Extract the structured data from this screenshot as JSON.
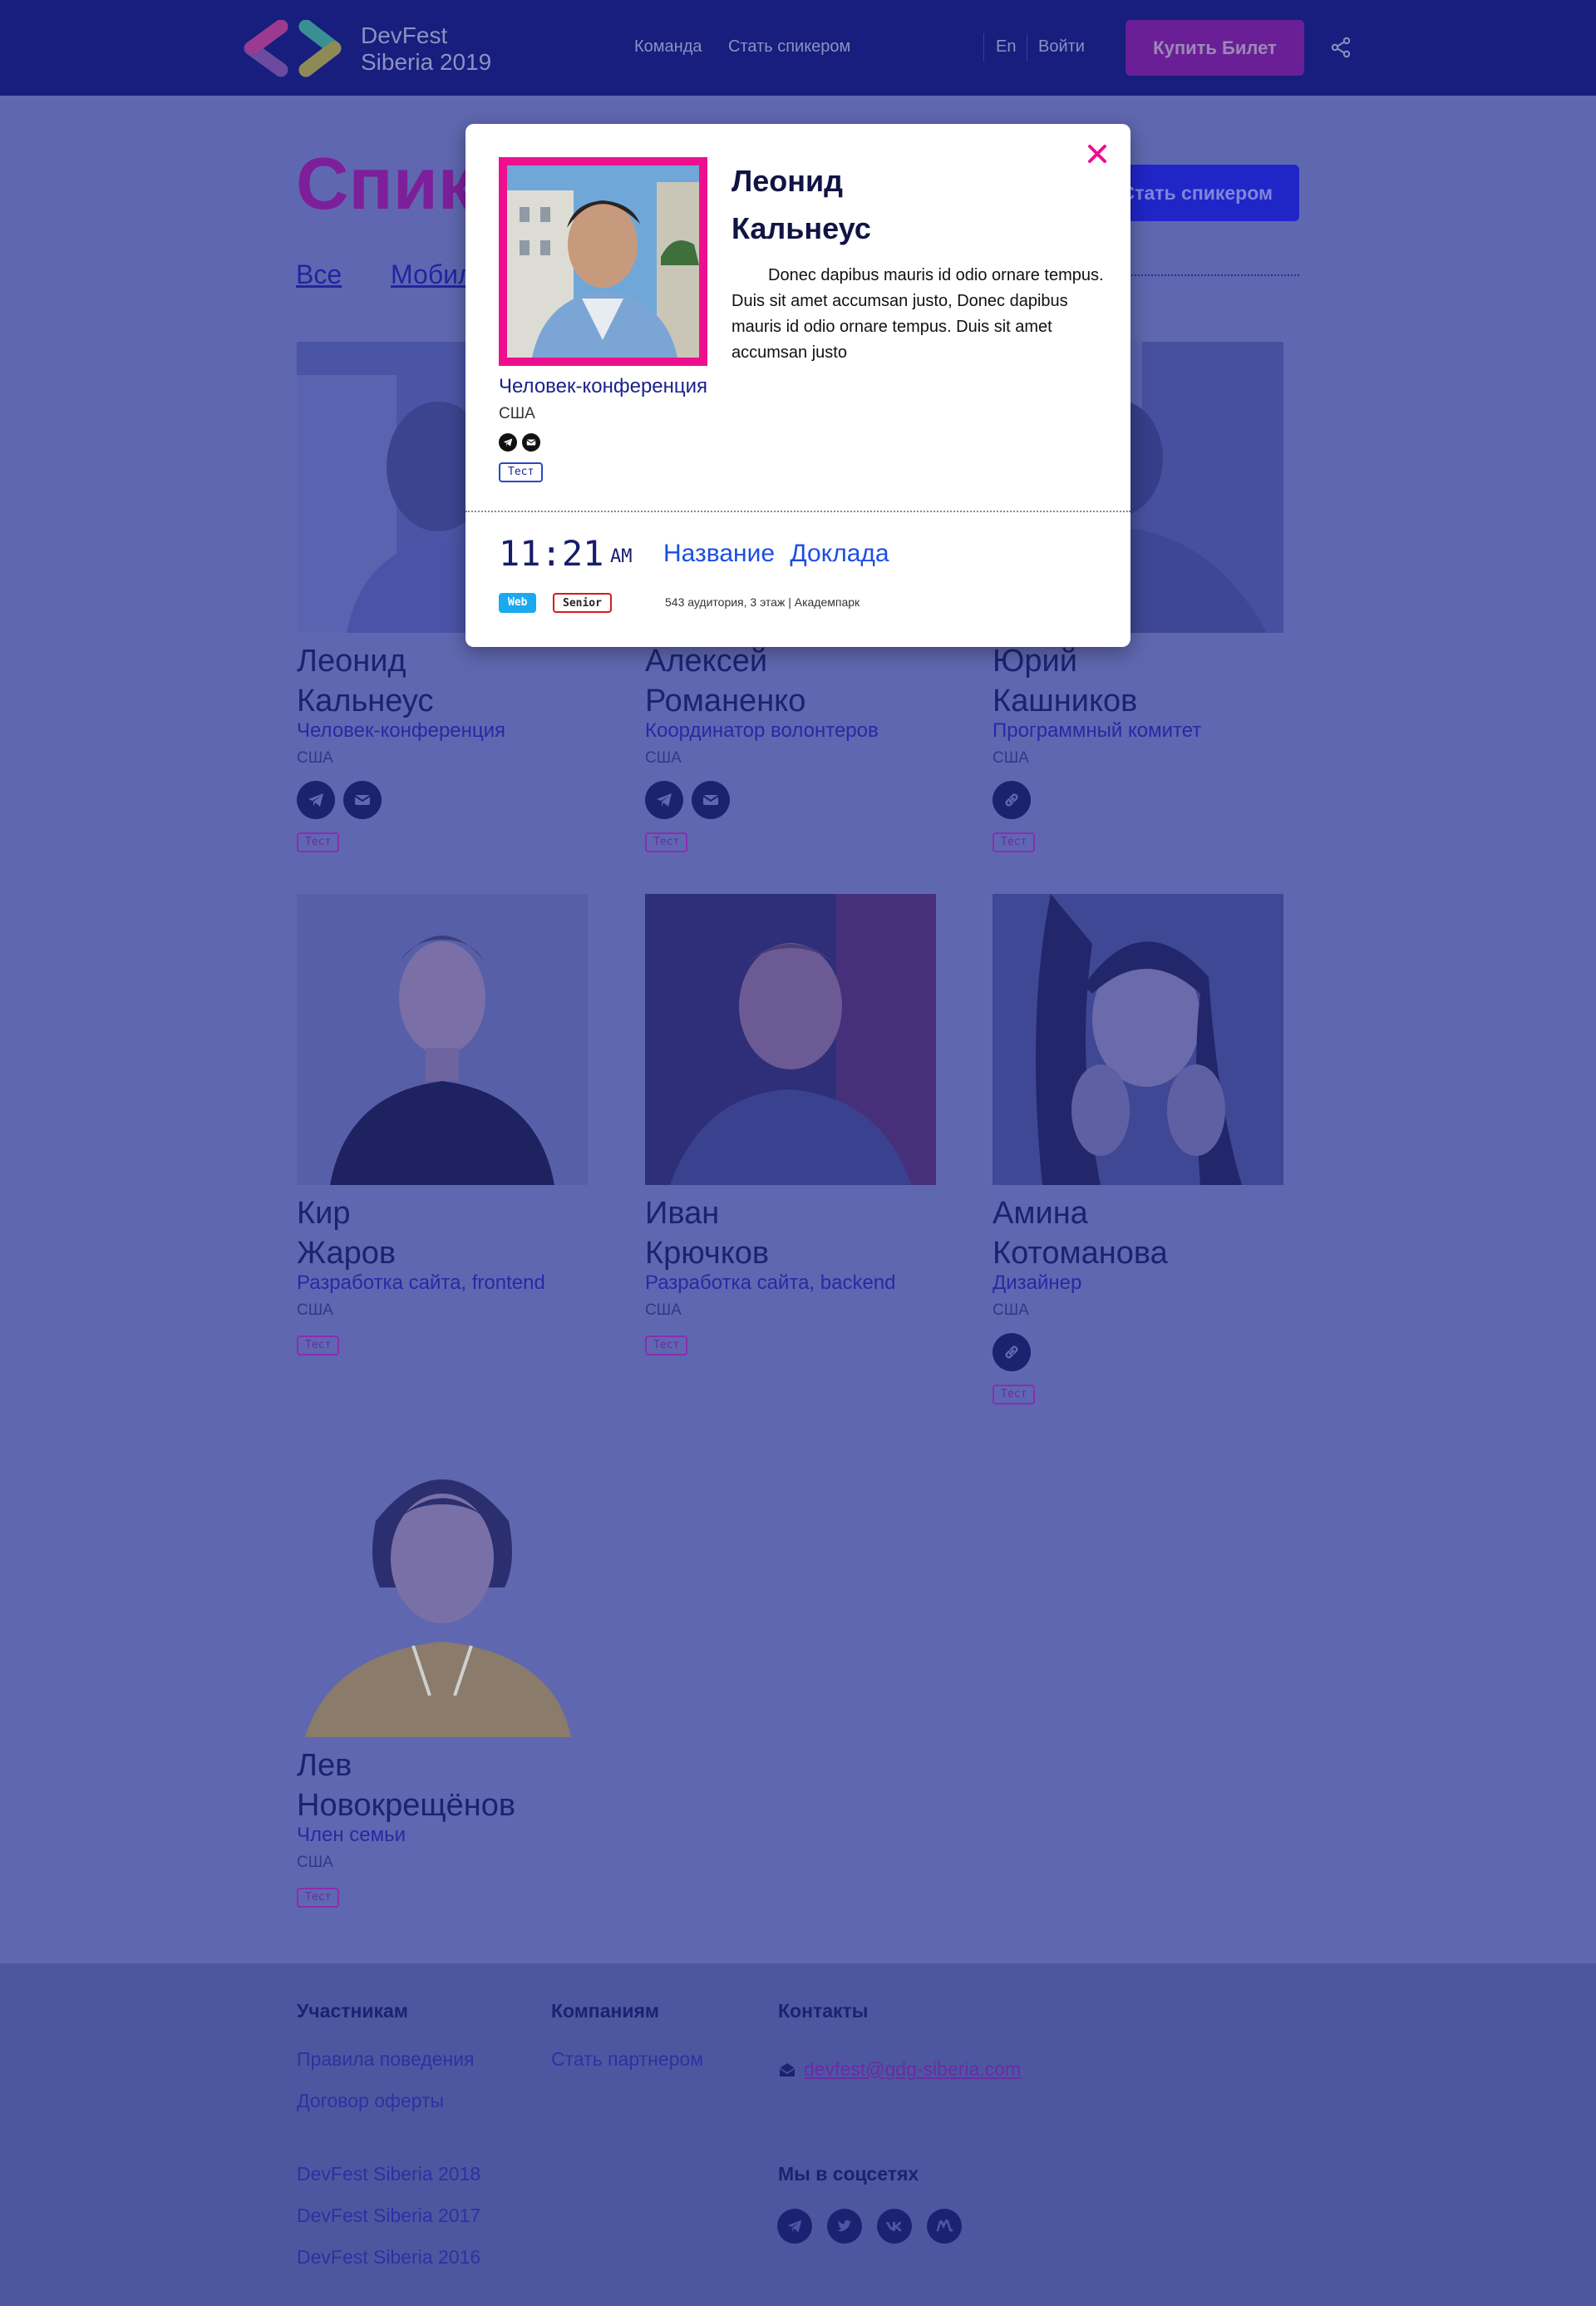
{
  "header": {
    "logo_line1": "DevFest",
    "logo_line2": "Siberia 2019",
    "nav": [
      "Команда",
      "Стать спикером"
    ],
    "lang": "En",
    "login": "Войти",
    "buy_ticket": "Купить Билет"
  },
  "page": {
    "title": "Спикеры",
    "become_speaker": "Стать спикером",
    "filters": [
      "Все",
      "Мобильная разработка"
    ]
  },
  "speakers": [
    {
      "first": "Леонид",
      "last": "Кальнеус",
      "role": "Человек-конференция",
      "country": "США",
      "socials": [
        "telegram-icon",
        "mail-icon"
      ],
      "tag": "Тест"
    },
    {
      "first": "Алексей",
      "last": "Романенко",
      "role": "Координатор волонтеров",
      "country": "США",
      "socials": [
        "telegram-icon",
        "mail-icon"
      ],
      "tag": "Тест"
    },
    {
      "first": "Юрий",
      "last": "Кашников",
      "role": "Программный комитет",
      "country": "США",
      "socials": [
        "link-icon"
      ],
      "tag": "Тест"
    },
    {
      "first": "Кир",
      "last": "Жаров",
      "role": "Разработка сайта, frontend",
      "country": "США",
      "socials": [],
      "tag": "Тест"
    },
    {
      "first": "Иван",
      "last": "Крючков",
      "role": "Разработка сайта, backend",
      "country": "США",
      "socials": [],
      "tag": "Тест"
    },
    {
      "first": "Амина",
      "last": "Котоманова",
      "role": "Дизайнер",
      "country": "США",
      "socials": [
        "link-icon"
      ],
      "tag": "Тест"
    },
    {
      "first": "Лев",
      "last": "Новокрещёнов",
      "role": "Член семьи",
      "country": "США",
      "socials": [],
      "tag": "Тест"
    }
  ],
  "modal": {
    "first": "Леонид",
    "last": "Кальнеус",
    "bio": "Donec dapibus mauris id odio ornare tempus. Duis sit amet accumsan justo, Donec dapibus mauris id odio ornare tempus. Duis sit amet accumsan justo",
    "role": "Человек-конференция",
    "country": "США",
    "tag": "Тест",
    "time": "11:21",
    "ampm": "AM",
    "talk_title": "Название Доклада",
    "track": "Web",
    "level": "Senior",
    "room": "543 аудитория, 3 этаж | Академпарк"
  },
  "footer": {
    "participants_title": "Участникам",
    "participants_links": [
      "Правила поведения",
      "Договор оферты"
    ],
    "companies_title": "Компаниям",
    "companies_links": [
      "Стать партнером"
    ],
    "contacts_title": "Контакты",
    "email": "devfest@gdg-siberia.com",
    "past_events": [
      "DevFest Siberia 2018",
      "DevFest Siberia 2017",
      "DevFest Siberia 2016"
    ],
    "social_title": "Мы в соцсетях",
    "social_icons": [
      "telegram-icon",
      "twitter-icon",
      "vk-icon",
      "meetup-icon"
    ]
  },
  "colors": {
    "overlay": "#5f67b0",
    "accent_pink": "#ee0f8f",
    "primary_blue": "#2025c8",
    "header_bg": "#171e7d"
  }
}
